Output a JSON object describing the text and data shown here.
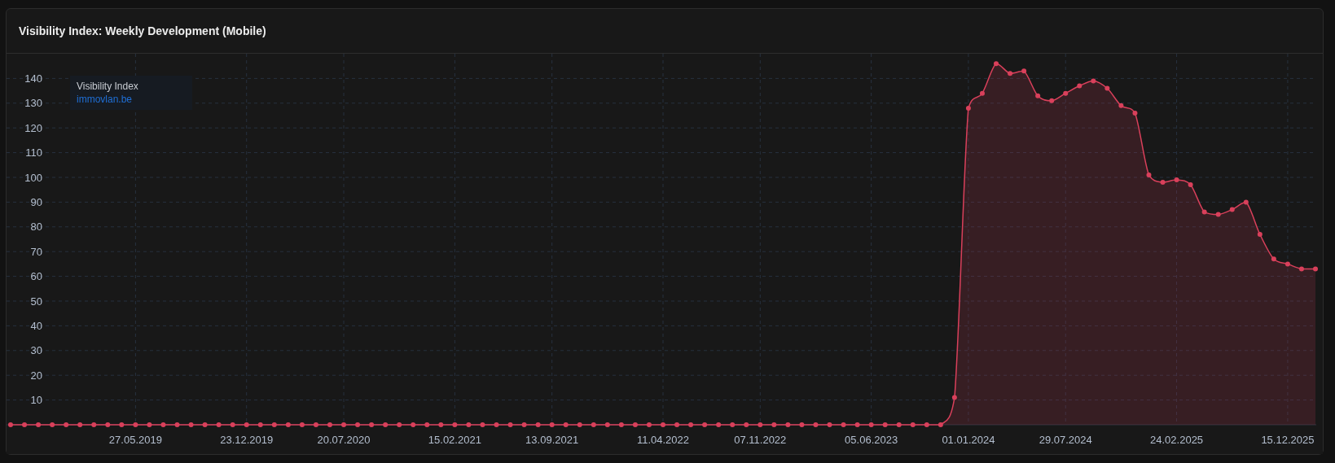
{
  "card": {
    "title": "Visibility Index: Weekly Development (Mobile)"
  },
  "legend": {
    "title": "Visibility Index"
  },
  "chart_data": {
    "type": "area",
    "grid": true,
    "ylim": [
      0,
      150
    ],
    "yticks": [
      10,
      20,
      30,
      40,
      50,
      60,
      70,
      80,
      90,
      100,
      110,
      120,
      130,
      140
    ],
    "categories": [
      null,
      null,
      null,
      null,
      null,
      null,
      null,
      null,
      null,
      "27.05.2019",
      null,
      null,
      null,
      null,
      null,
      null,
      null,
      "23.12.2019",
      null,
      null,
      null,
      null,
      null,
      null,
      "20.07.2020",
      null,
      null,
      null,
      null,
      null,
      null,
      null,
      "15.02.2021",
      null,
      null,
      null,
      null,
      null,
      null,
      "13.09.2021",
      null,
      null,
      null,
      null,
      null,
      null,
      null,
      "11.04.2022",
      null,
      null,
      null,
      null,
      null,
      null,
      "07.11.2022",
      null,
      null,
      null,
      null,
      null,
      null,
      null,
      "05.06.2023",
      null,
      null,
      null,
      null,
      null,
      null,
      "01.01.2024",
      null,
      null,
      null,
      null,
      null,
      null,
      "29.07.2024",
      null,
      null,
      null,
      null,
      null,
      null,
      null,
      "24.02.2025",
      null,
      null,
      null,
      null,
      null,
      null,
      null,
      "15.12.2025",
      null,
      null
    ],
    "series": [
      {
        "name": "immovlan.be",
        "color": "#d9405b",
        "values": [
          0,
          0,
          0,
          0,
          0,
          0,
          0,
          0,
          0,
          0,
          0,
          0,
          0,
          0,
          0,
          0,
          0,
          0,
          0,
          0,
          0,
          0,
          0,
          0,
          0,
          0,
          0,
          0,
          0,
          0,
          0,
          0,
          0,
          0,
          0,
          0,
          0,
          0,
          0,
          0,
          0,
          0,
          0,
          0,
          0,
          0,
          0,
          0,
          0,
          0,
          0,
          0,
          0,
          0,
          0,
          0,
          0,
          0,
          0,
          0,
          0,
          0,
          0,
          0,
          0,
          0,
          0,
          0,
          11,
          128,
          134,
          146,
          142,
          143,
          133,
          131,
          134,
          137,
          139,
          136,
          129,
          126,
          101,
          98,
          99,
          97,
          86,
          85,
          87,
          90,
          77,
          67,
          65,
          63,
          63
        ]
      }
    ]
  }
}
